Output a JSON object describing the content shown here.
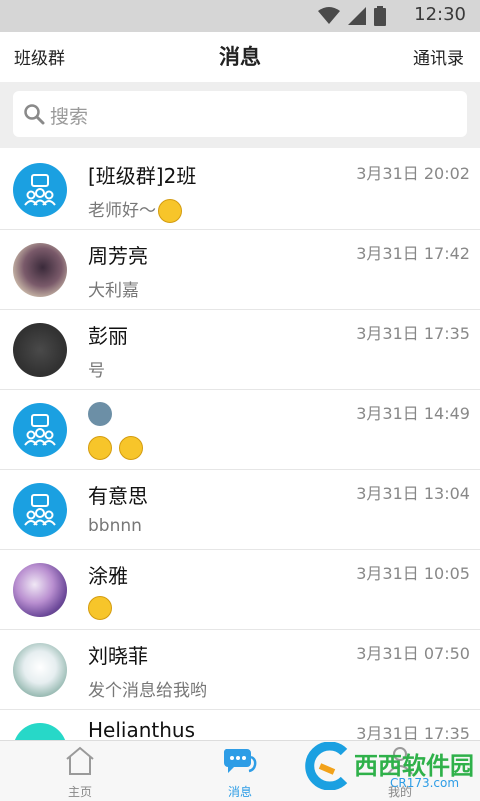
{
  "status": {
    "time": "12:30"
  },
  "appbar": {
    "left": "班级群",
    "title": "消息",
    "right": "通讯录"
  },
  "search": {
    "placeholder": "搜索"
  },
  "conversations": [
    {
      "name": "[班级群]2班",
      "preview": "老师好～",
      "time": "3月31日 20:02",
      "avatar": "group-icon",
      "emojis": [
        "grin-emoji"
      ]
    },
    {
      "name": "周芳亮",
      "preview": "大利嘉",
      "time": "3月31日 17:42",
      "avatar": "photo"
    },
    {
      "name": "彭丽",
      "preview": "号",
      "time": "3月31日 17:35",
      "avatar": "photo"
    },
    {
      "name": "",
      "preview": "",
      "time": "3月31日 14:49",
      "avatar": "group-icon",
      "emojis": [
        "alien-emoji",
        "sleepy-emoji",
        "grin-emoji"
      ]
    },
    {
      "name": "有意思",
      "preview": "bbnnn",
      "time": "3月31日 13:04",
      "avatar": "group-icon"
    },
    {
      "name": "涂雅",
      "preview": "",
      "time": "3月31日 10:05",
      "avatar": "photo",
      "emojis": [
        "dizzy-emoji"
      ]
    },
    {
      "name": "刘晓菲",
      "preview": "发个消息给我哟",
      "time": "3月31日 07:50",
      "avatar": "photo"
    },
    {
      "name": "Helianthus",
      "preview": "",
      "time": "3月31日 17:35",
      "avatar": "teal-circle"
    }
  ],
  "tabs": [
    {
      "label": "主页"
    },
    {
      "label": "消息"
    },
    {
      "label": "我的"
    }
  ],
  "watermark": {
    "text": "西西软件园",
    "url": "CR173.com"
  },
  "colors": {
    "accent": "#2e9de6",
    "group_avatar": "#1ba0e1",
    "teal": "#27d8c8"
  }
}
